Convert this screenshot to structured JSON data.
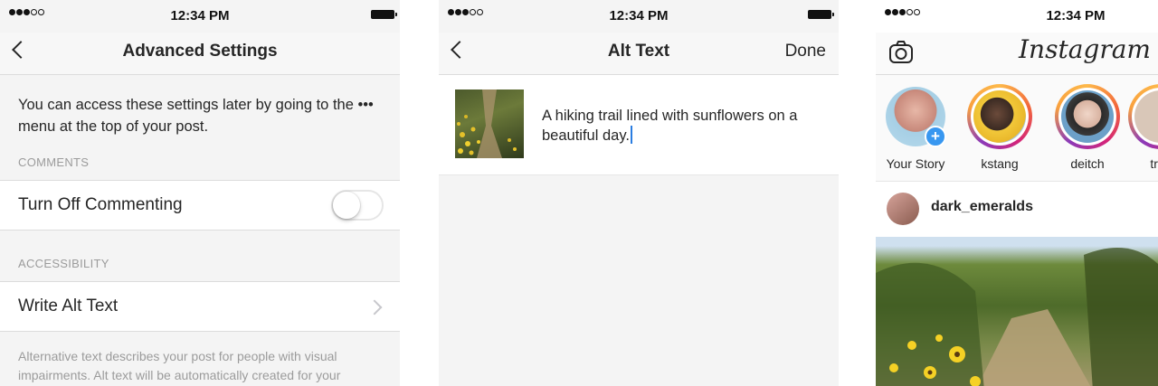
{
  "status_bar": {
    "time": "12:34 PM"
  },
  "screen1": {
    "title": "Advanced Settings",
    "intro": "You can access these settings later by going to the ••• menu at the top of your post.",
    "comments_header": "COMMENTS",
    "turn_off_commenting_label": "Turn Off Commenting",
    "turn_off_commenting_on": false,
    "accessibility_header": "ACCESSIBILITY",
    "write_alt_text_label": "Write Alt Text",
    "footnote": "Alternative text describes your post for people with visual impairments. Alt text will be automatically created for your"
  },
  "screen2": {
    "title": "Alt Text",
    "done_label": "Done",
    "alt_text_value": "A hiking trail lined with sunflowers on a beautiful day."
  },
  "screen3": {
    "logo": "Instagram",
    "stories": [
      {
        "name": "Your Story"
      },
      {
        "name": "kstang"
      },
      {
        "name": "deitch"
      },
      {
        "name": "trav"
      }
    ],
    "post_username": "dark_emeralds"
  },
  "colors": {
    "accent_blue": "#3897f0",
    "caret_blue": "#2a7de1",
    "secondary_text": "#9b9b9b"
  }
}
